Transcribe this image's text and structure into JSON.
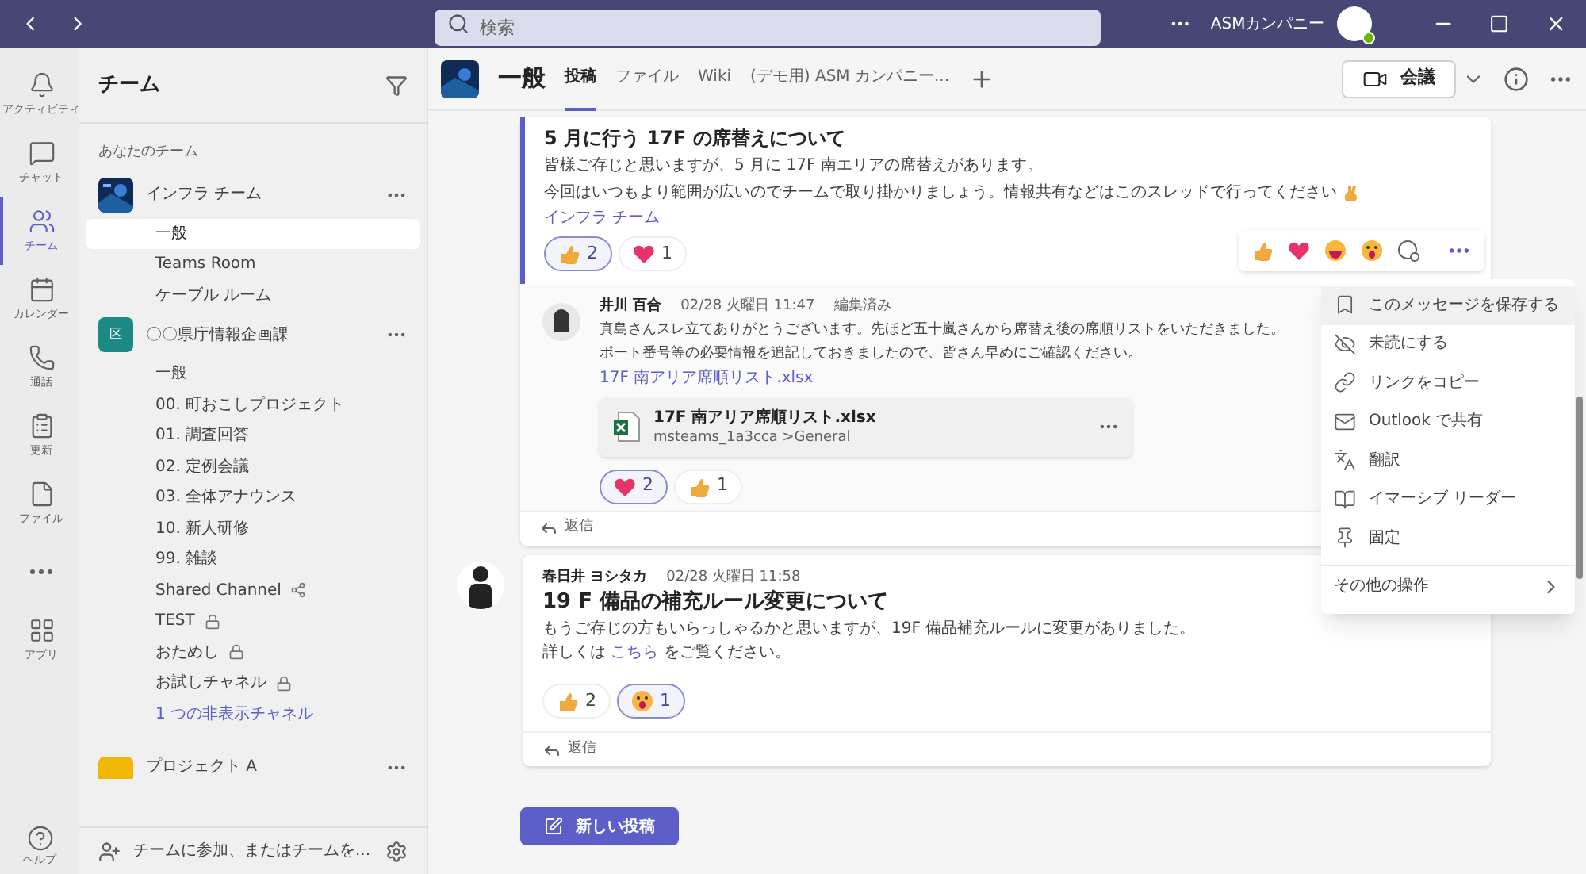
{
  "top_bar": {
    "search_placeholder": "検索",
    "org": "ASMカンパニー"
  },
  "rail": [
    {
      "label": "アクティビティ",
      "kind": "bell",
      "selected": false
    },
    {
      "label": "チャット",
      "kind": "chat",
      "selected": false
    },
    {
      "label": "チーム",
      "kind": "teams",
      "selected": true
    },
    {
      "label": "カレンダー",
      "kind": "calendar",
      "selected": false
    },
    {
      "label": "通話",
      "kind": "phone",
      "selected": false
    },
    {
      "label": "更新",
      "kind": "updates",
      "selected": false
    },
    {
      "label": "ファイル",
      "kind": "file",
      "selected": false
    },
    {
      "kind": "more",
      "selected": false
    },
    {
      "label": "アプリ",
      "kind": "apps",
      "selected": false
    }
  ],
  "rail_help": "ヘルプ",
  "teams_panel": {
    "title": "チーム",
    "section": "あなたのチーム",
    "teams": [
      {
        "name": "インフラ チーム",
        "kind": "picture",
        "channels": [
          {
            "name": "一般",
            "selected": true
          },
          {
            "name": "Teams Room",
            "selected": false
          },
          {
            "name": "ケーブル ルーム",
            "selected": false
          }
        ]
      },
      {
        "name": "〇〇県庁情報企画課",
        "kind": "initial",
        "initial": "区",
        "channels": [
          {
            "name": "一般",
            "selected": false
          },
          {
            "name": "00. 町おこしプロジェクト",
            "selected": false
          },
          {
            "name": "01. 調査回答",
            "selected": false
          },
          {
            "name": "02. 定例会議",
            "selected": false
          },
          {
            "name": "03. 全体アナウンス",
            "selected": false
          },
          {
            "name": "10. 新人研修",
            "selected": false
          },
          {
            "name": "99. 雑談",
            "selected": false
          },
          {
            "name": "Shared Channel",
            "selected": false,
            "kind": "shared"
          },
          {
            "name": "TEST",
            "selected": false,
            "kind": "private"
          },
          {
            "name": "おためし",
            "selected": false,
            "kind": "private"
          },
          {
            "name": "お試しチャネル",
            "selected": false,
            "kind": "private"
          }
        ],
        "hidden_link": "1 つの非表示チャネル"
      },
      {
        "name": "プロジェクト A",
        "kind": "yellow"
      }
    ],
    "footer": "チームに参加、またはチームを..."
  },
  "channel_header": {
    "title": "一般",
    "tabs": [
      {
        "label": "投稿",
        "selected": true
      },
      {
        "label": "ファイル",
        "selected": false
      },
      {
        "label": "Wiki",
        "selected": false
      },
      {
        "label": "(デモ用) ASM カンパニー...",
        "selected": false
      }
    ],
    "meet": "会議"
  },
  "posts": [
    {
      "title": "5 月に行う 17F の席替えについて",
      "lines": [
        "皆様ご存じと思いますが、5 月に 17F 南エリアの席替えがあります。",
        "今回はいつもより範囲が広いのでチームで取り掛かりましょう。情報共有などはこのスレッドで行ってください"
      ],
      "tag": "インフラ チーム",
      "reactions": [
        {
          "kind": "like",
          "count": "2",
          "selected": true
        },
        {
          "kind": "heart",
          "count": "1",
          "selected": false
        }
      ],
      "reply": {
        "author": "井川 百合",
        "date": "02/28 火曜日 11:47",
        "edited": "編集済み",
        "lines": [
          "真島さんスレ立てありがとうございます。先ほど五十嵐さんから席替え後の席順リストをいただきました。",
          "ポート番号等の必要情報を追記しておきましたので、皆さん早めにご確認ください。"
        ],
        "link": "17F 南アリア席順リスト.xlsx",
        "file": {
          "name": "17F 南アリア席順リスト.xlsx",
          "path": "msteams_1a3cca >General"
        },
        "reactions": [
          {
            "kind": "heart",
            "count": "2",
            "selected": true
          },
          {
            "kind": "like",
            "count": "1",
            "selected": false
          }
        ]
      },
      "reply_label": "返信"
    },
    {
      "author": "春日井 ヨシタカ",
      "date": "02/28 火曜日 11:58",
      "title": "19 F 備品の補充ルール変更について",
      "lines": [
        "もうご存じの方もいらっしゃるかと思いますが、19F 備品補充ルールに変更がありました。"
      ],
      "link_line": {
        "before": "詳しくは ",
        "link": "こちら",
        "after": " をご覧ください。"
      },
      "reactions": [
        {
          "kind": "like",
          "count": "2",
          "selected": false
        },
        {
          "kind": "surprised",
          "count": "1",
          "selected": true
        }
      ],
      "reply_label": "返信"
    }
  ],
  "menu": {
    "items": [
      {
        "label": "このメッセージを保存する",
        "kind": "bookmark",
        "selected": true
      },
      {
        "label": "未読にする",
        "kind": "unread",
        "selected": false
      },
      {
        "label": "リンクをコピー",
        "kind": "link",
        "selected": false
      },
      {
        "label": "Outlook で共有",
        "kind": "mail",
        "selected": false
      },
      {
        "label": "翻訳",
        "kind": "translate",
        "selected": false
      },
      {
        "label": "イマーシブ リーダー",
        "kind": "reader",
        "selected": false
      },
      {
        "label": "固定",
        "kind": "pin",
        "selected": false
      }
    ],
    "more": "その他の操作"
  },
  "new_post": "新しい投稿"
}
